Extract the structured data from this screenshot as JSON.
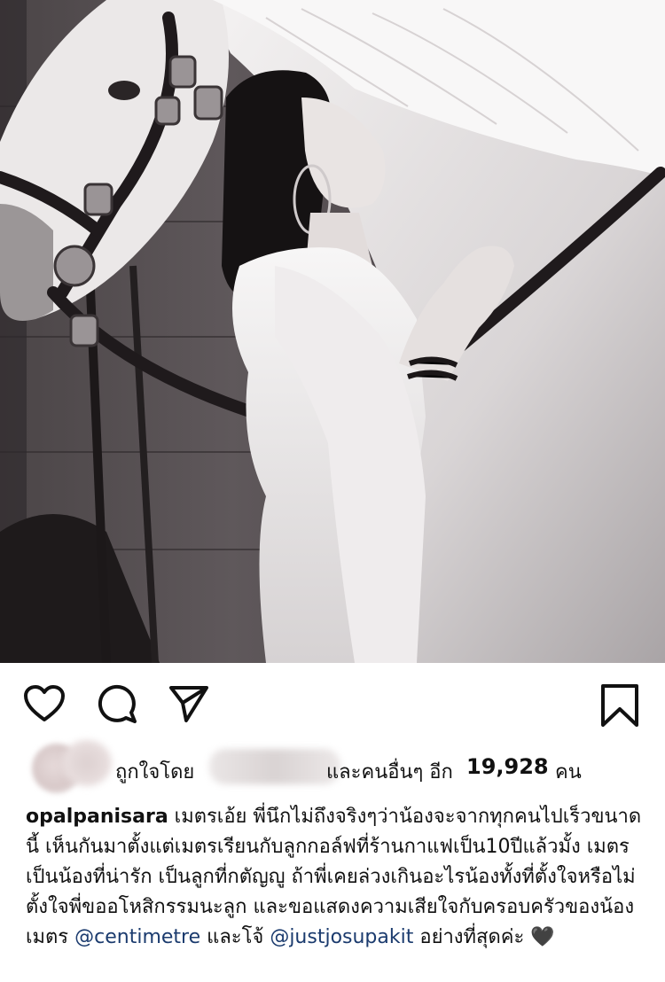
{
  "post": {
    "image_alt": "Black and white photo of a woman in a long white dress leaning against a white horse",
    "actions": {
      "like_icon": "heart-icon",
      "comment_icon": "comment-icon",
      "share_icon": "share-icon",
      "save_icon": "bookmark-icon"
    },
    "likes": {
      "prefix": "ถูกใจโดย",
      "suffix": "และคนอื่นๆ อีก",
      "count": "19,928",
      "unit": "คน"
    },
    "caption": {
      "username": "opalpanisara",
      "text_1": " เมตรเอ้ย พี่นึกไม่ถึงจริงๆว่าน้องจะจากทุกคนไปเร็วขนาดนี้ เห็นกันมาตั้งแต่เมตรเรียนกับลูกกอล์ฟที่ร้านกาแฟเป็น10ปีแล้วมั้ง เมตรเป็นน้องที่น่ารัก เป็นลูกที่กตัญญู ถ้าพี่เคยล่วงเกินอะไรน้องทั้งที่ตั้งใจหรือไม่ตั้งใจพี่ขออโหสิกรรมนะลูก และขอแสดงความเสียใจกับครอบครัวของน้องเมตร ",
      "mention_1": "@centimetre",
      "text_2": " และโจ้ ",
      "mention_2": "@justjosupakit",
      "text_3": " อย่างที่สุดค่ะ ",
      "emoji": "🖤"
    }
  }
}
